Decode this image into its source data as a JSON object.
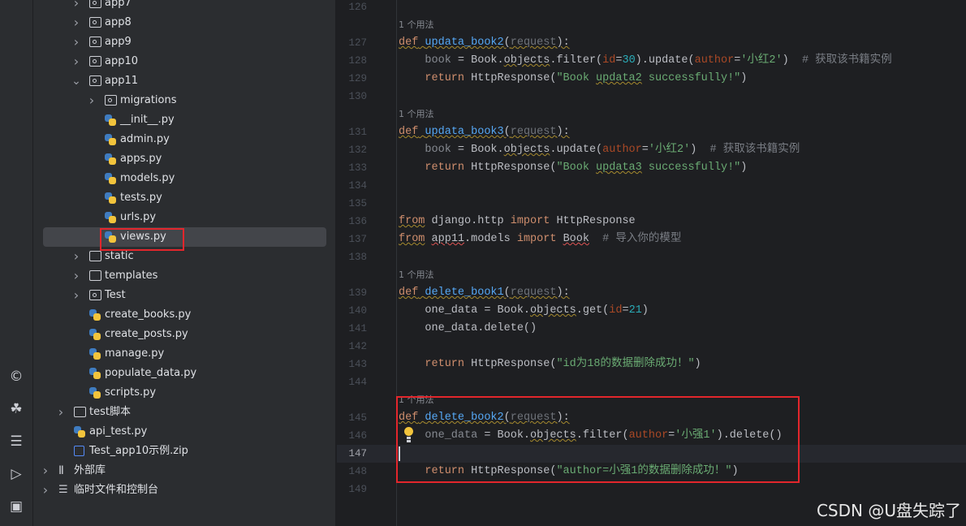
{
  "activity_bar": {
    "icons": [
      "ai-assistant-icon",
      "python-console-icon",
      "layers-icon",
      "services-run-icon",
      "terminal-icon"
    ]
  },
  "tree": {
    "items": [
      {
        "label": "app7",
        "type": "pkg",
        "depth": 1,
        "expand": "closed"
      },
      {
        "label": "app8",
        "type": "pkg",
        "depth": 1,
        "expand": "closed"
      },
      {
        "label": "app9",
        "type": "pkg",
        "depth": 1,
        "expand": "closed"
      },
      {
        "label": "app10",
        "type": "pkg",
        "depth": 1,
        "expand": "closed"
      },
      {
        "label": "app11",
        "type": "pkg",
        "depth": 1,
        "expand": "open"
      },
      {
        "label": "migrations",
        "type": "pkg",
        "depth": 2,
        "expand": "closed"
      },
      {
        "label": "__init__.py",
        "type": "py",
        "depth": 2
      },
      {
        "label": "admin.py",
        "type": "py",
        "depth": 2
      },
      {
        "label": "apps.py",
        "type": "py",
        "depth": 2
      },
      {
        "label": "models.py",
        "type": "py",
        "depth": 2
      },
      {
        "label": "tests.py",
        "type": "py",
        "depth": 2
      },
      {
        "label": "urls.py",
        "type": "py",
        "depth": 2
      },
      {
        "label": "views.py",
        "type": "py",
        "depth": 2,
        "selected": true
      },
      {
        "label": "static",
        "type": "folder",
        "depth": 1,
        "expand": "closed"
      },
      {
        "label": "templates",
        "type": "folder",
        "depth": 1,
        "expand": "closed"
      },
      {
        "label": "Test",
        "type": "pkg",
        "depth": 1,
        "expand": "closed"
      },
      {
        "label": "create_books.py",
        "type": "py",
        "depth": 1
      },
      {
        "label": "create_posts.py",
        "type": "py",
        "depth": 1
      },
      {
        "label": "manage.py",
        "type": "py",
        "depth": 1
      },
      {
        "label": "populate_data.py",
        "type": "py",
        "depth": 1
      },
      {
        "label": "scripts.py",
        "type": "py",
        "depth": 1
      },
      {
        "label": "test脚本",
        "type": "folder",
        "depth": 0,
        "expand": "closed"
      },
      {
        "label": "api_test.py",
        "type": "py",
        "depth": 0
      },
      {
        "label": "Test_app10示例.zip",
        "type": "zip",
        "depth": 0
      },
      {
        "label": "外部库",
        "type": "lib",
        "depth": -1,
        "expand": "closed"
      },
      {
        "label": "临时文件和控制台",
        "type": "scratch",
        "depth": -1,
        "expand": "closed"
      }
    ]
  },
  "editor": {
    "current_line": "147",
    "rows": [
      {
        "n": "126",
        "t": []
      },
      {
        "hint": "1 个用法"
      },
      {
        "n": "127",
        "t": [
          [
            "def",
            "kw wv"
          ],
          [
            " ",
            "wv"
          ],
          [
            "updata_book2",
            "fn wv"
          ],
          [
            "(",
            "wv"
          ],
          [
            "request",
            "par wv"
          ],
          [
            "):",
            "wv"
          ]
        ]
      },
      {
        "n": "128",
        "t": [
          [
            "    "
          ],
          [
            "book",
            "unused"
          ],
          [
            " = Book."
          ],
          [
            "objects",
            "wv"
          ],
          [
            ".filter("
          ],
          [
            "id",
            "arg"
          ],
          [
            "="
          ],
          [
            "30",
            "num"
          ],
          [
            ").update("
          ],
          [
            "author",
            "arg"
          ],
          [
            "="
          ],
          [
            "'小红2'",
            "str"
          ],
          [
            ")  "
          ],
          [
            "# 获取该书籍实例",
            "cm"
          ]
        ]
      },
      {
        "n": "129",
        "t": [
          [
            "    "
          ],
          [
            "return",
            "kw"
          ],
          [
            " HttpResponse("
          ],
          [
            "\"Book ",
            "str"
          ],
          [
            "updata2",
            "str wv"
          ],
          [
            " successfully!\"",
            "str"
          ],
          [
            ")"
          ]
        ]
      },
      {
        "n": "130",
        "t": []
      },
      {
        "hint": "1 个用法"
      },
      {
        "n": "131",
        "t": [
          [
            "def",
            "kw wv"
          ],
          [
            " ",
            "wv"
          ],
          [
            "updata_book3",
            "fn wv"
          ],
          [
            "(",
            "wv"
          ],
          [
            "request",
            "par wv"
          ],
          [
            "):",
            "wv"
          ]
        ]
      },
      {
        "n": "132",
        "t": [
          [
            "    "
          ],
          [
            "book",
            "unused"
          ],
          [
            " = Book."
          ],
          [
            "objects",
            "wv"
          ],
          [
            ".update("
          ],
          [
            "author",
            "arg"
          ],
          [
            "="
          ],
          [
            "'小红2'",
            "str"
          ],
          [
            ")  "
          ],
          [
            "# 获取该书籍实例",
            "cm"
          ]
        ]
      },
      {
        "n": "133",
        "t": [
          [
            "    "
          ],
          [
            "return",
            "kw"
          ],
          [
            " HttpResponse("
          ],
          [
            "\"Book ",
            "str"
          ],
          [
            "updata3",
            "str wv"
          ],
          [
            " successfully!\"",
            "str"
          ],
          [
            ")"
          ]
        ]
      },
      {
        "n": "134",
        "t": []
      },
      {
        "n": "135",
        "t": []
      },
      {
        "n": "136",
        "t": [
          [
            "from",
            "kw wv"
          ],
          [
            " django.http "
          ],
          [
            "import",
            "kw"
          ],
          [
            " HttpResponse"
          ]
        ]
      },
      {
        "n": "137",
        "t": [
          [
            "from",
            "kw wv"
          ],
          [
            " "
          ],
          [
            "app11",
            "wvr"
          ],
          [
            ".models "
          ],
          [
            "import",
            "kw"
          ],
          [
            " "
          ],
          [
            "Book",
            "wvr"
          ],
          [
            "  "
          ],
          [
            "# 导入你的模型",
            "cm"
          ]
        ]
      },
      {
        "n": "138",
        "t": []
      },
      {
        "hint": "1 个用法"
      },
      {
        "n": "139",
        "t": [
          [
            "def",
            "kw wv"
          ],
          [
            " ",
            "wv"
          ],
          [
            "delete_book1",
            "fn wv"
          ],
          [
            "(",
            "wv"
          ],
          [
            "request",
            "par wv"
          ],
          [
            "):",
            "wv"
          ]
        ]
      },
      {
        "n": "140",
        "t": [
          [
            "    one_data = Book."
          ],
          [
            "objects",
            "wv"
          ],
          [
            ".get("
          ],
          [
            "id",
            "arg"
          ],
          [
            "="
          ],
          [
            "21",
            "num"
          ],
          [
            ")"
          ]
        ]
      },
      {
        "n": "141",
        "t": [
          [
            "    one_data.delete()"
          ]
        ]
      },
      {
        "n": "142",
        "t": []
      },
      {
        "n": "143",
        "t": [
          [
            "    "
          ],
          [
            "return",
            "kw"
          ],
          [
            " HttpResponse("
          ],
          [
            "\"id为18的数据删除成功！\"",
            "str"
          ],
          [
            ")"
          ]
        ]
      },
      {
        "n": "144",
        "t": []
      },
      {
        "hint": "1 个用法"
      },
      {
        "n": "145",
        "t": [
          [
            "def",
            "kw wv"
          ],
          [
            " ",
            "wv"
          ],
          [
            "delete_book2",
            "fn wv"
          ],
          [
            "(",
            "wv"
          ],
          [
            "request",
            "par wv"
          ],
          [
            "):",
            "wv"
          ]
        ]
      },
      {
        "n": "146",
        "t": [
          [
            "    "
          ],
          [
            "one_data",
            "unused"
          ],
          [
            " = Book."
          ],
          [
            "objects",
            "wv"
          ],
          [
            ".filter("
          ],
          [
            "author",
            "arg"
          ],
          [
            "="
          ],
          [
            "'小强1'",
            "str"
          ],
          [
            ").delete()"
          ]
        ]
      },
      {
        "n": "147",
        "t": [],
        "current": true
      },
      {
        "n": "148",
        "t": [
          [
            "    "
          ],
          [
            "return",
            "kw"
          ],
          [
            " HttpResponse("
          ],
          [
            "\"author=小强1的数据删除成功！\"",
            "str"
          ],
          [
            ")"
          ]
        ]
      },
      {
        "n": "149",
        "t": []
      }
    ]
  },
  "watermark": "CSDN @U盘失踪了",
  "colors": {
    "highlight_box": "#e3262c",
    "keyword": "#cf8e6d",
    "function": "#56a8f5",
    "string": "#6aab73"
  }
}
